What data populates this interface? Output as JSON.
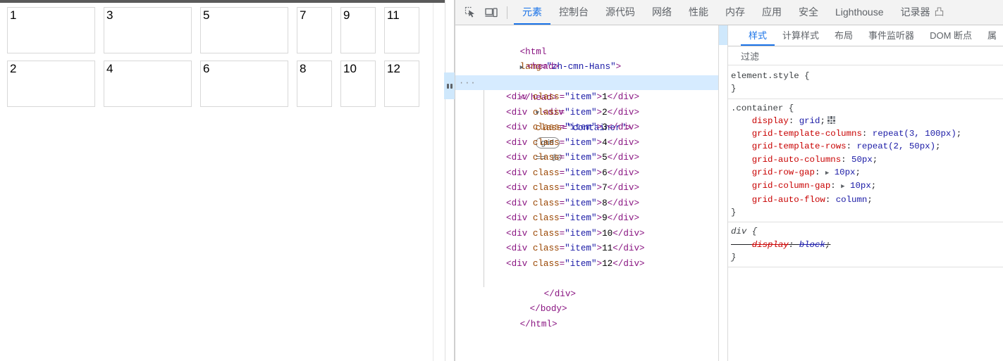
{
  "page": {
    "lang": "zh-cmn-Hans",
    "grid_items": [
      "1",
      "2",
      "3",
      "4",
      "5",
      "6",
      "7",
      "8",
      "9",
      "10",
      "11",
      "12"
    ]
  },
  "devtools": {
    "toolbar": {
      "inspect_icon": "inspect-element-icon",
      "device_icon": "device-toolbar-icon",
      "tabs": [
        {
          "label": "元素",
          "active": true
        },
        {
          "label": "控制台",
          "active": false
        },
        {
          "label": "源代码",
          "active": false
        },
        {
          "label": "网络",
          "active": false
        },
        {
          "label": "性能",
          "active": false
        },
        {
          "label": "内存",
          "active": false
        },
        {
          "label": "应用",
          "active": false
        },
        {
          "label": "安全",
          "active": false
        },
        {
          "label": "Lighthouse",
          "active": false
        },
        {
          "label": "记录器",
          "active": false,
          "suffix": "凸"
        }
      ]
    },
    "dom": {
      "lines": [
        {
          "indent": 0,
          "tri": "",
          "text_html": "html_open"
        },
        {
          "indent": 0,
          "tri": "▶",
          "text_html": "head_collapsed"
        },
        {
          "indent": 0,
          "tri": "▼",
          "text_html": "body_open"
        }
      ],
      "html_tag": "html",
      "html_attr_name": "lang",
      "html_attr_value": "\"zh-cmn-Hans\"",
      "head_tag": "head",
      "body_tag": "body",
      "container_tag": "div",
      "container_attr_name": "class",
      "container_attr_value": "\"container\"",
      "grid_badge": "grid",
      "selection_marker": "== $0",
      "item_attr_value": "\"item\"",
      "ellipsis_badge": "…",
      "row_dots": "···"
    },
    "styles": {
      "tabs": [
        {
          "label": "样式",
          "active": true
        },
        {
          "label": "计算样式",
          "active": false
        },
        {
          "label": "布局",
          "active": false
        },
        {
          "label": "事件监听器",
          "active": false
        },
        {
          "label": "DOM 断点",
          "active": false
        },
        {
          "label": "属",
          "active": false
        }
      ],
      "filter_placeholder": "过滤",
      "rules": [
        {
          "selector": "element.style",
          "ua": false,
          "declarations": []
        },
        {
          "selector": ".container",
          "ua": false,
          "declarations": [
            {
              "prop": "display",
              "value": "grid",
              "badge": "grid-editor-icon",
              "toggle": false,
              "struck": false
            },
            {
              "prop": "grid-template-columns",
              "value": "repeat(3, 100px)",
              "toggle": false,
              "struck": false
            },
            {
              "prop": "grid-template-rows",
              "value": "repeat(2, 50px)",
              "toggle": false,
              "struck": false
            },
            {
              "prop": "grid-auto-columns",
              "value": "50px",
              "toggle": false,
              "struck": false
            },
            {
              "prop": "grid-row-gap",
              "value": "10px",
              "toggle": true,
              "struck": false
            },
            {
              "prop": "grid-column-gap",
              "value": "10px",
              "toggle": true,
              "struck": false
            },
            {
              "prop": "grid-auto-flow",
              "value": "column",
              "toggle": false,
              "struck": false
            }
          ]
        },
        {
          "selector": "div",
          "ua": true,
          "declarations": [
            {
              "prop": "display",
              "value": "block",
              "toggle": false,
              "struck": true
            }
          ]
        }
      ]
    }
  },
  "colors": {
    "accent": "#1a73e8",
    "selection_bg": "#d6ebff",
    "toolbar_bg": "#f3f3f3",
    "tag": "#881280",
    "attr_name": "#994500",
    "attr_value": "#1a1aa6",
    "css_prop": "#c80000",
    "css_value": "#1a1aa6",
    "item_border": "#d8d8d8"
  }
}
